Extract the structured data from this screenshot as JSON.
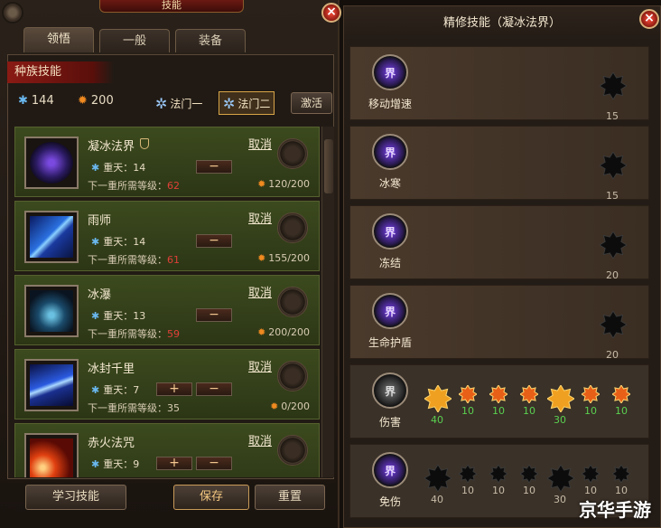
{
  "window": {
    "title": "技能"
  },
  "tabs": [
    {
      "label": "领悟"
    },
    {
      "label": "一般"
    },
    {
      "label": "装备"
    }
  ],
  "race_banner": "种族技能",
  "currency": {
    "blue": "144",
    "orange": "200"
  },
  "schools": [
    {
      "label": "法门一"
    },
    {
      "label": "法门二"
    }
  ],
  "activate_label": "激活",
  "skills": [
    {
      "name": "凝冰法界",
      "cancel": "取消",
      "level_label": "重天：14",
      "next_label": "下一重所需等级：",
      "next_level": "62",
      "points": "120/200"
    },
    {
      "name": "雨师",
      "cancel": "取消",
      "level_label": "重天：14",
      "next_label": "下一重所需等级：",
      "next_level": "61",
      "points": "155/200"
    },
    {
      "name": "冰瀑",
      "cancel": "取消",
      "level_label": "重天：13",
      "next_label": "下一重所需等级：",
      "next_level": "59",
      "points": "200/200"
    },
    {
      "name": "冰封千里",
      "cancel": "取消",
      "level_label": "重天：7",
      "next_label": "下一重所需等级：",
      "next_level": "35",
      "points": "0/200"
    },
    {
      "name": "赤火法咒",
      "cancel": "取消",
      "level_label": "重天：9",
      "next_label": "",
      "next_level": "",
      "points": ""
    }
  ],
  "bottom": {
    "learn": "学习技能",
    "save": "保存",
    "reset": "重置"
  },
  "right_panel": {
    "title": "精修技能（凝冰法界）",
    "icon_glyph": "界",
    "rows": [
      {
        "label": "移动增速",
        "nodes": [
          "15"
        ]
      },
      {
        "label": "冰寒",
        "nodes": [
          "15"
        ]
      },
      {
        "label": "冻结",
        "nodes": [
          "20"
        ]
      },
      {
        "label": "生命护盾",
        "nodes": [
          "20"
        ]
      },
      {
        "label": "伤害",
        "nodes": [
          "40",
          "10",
          "10",
          "10",
          "30",
          "10",
          "10"
        ]
      },
      {
        "label": "免伤",
        "nodes": [
          "40",
          "10",
          "10",
          "10",
          "30",
          "10",
          "10"
        ]
      }
    ]
  },
  "watermark": "京华手游",
  "colors": {
    "accent_red": "#8a1a14",
    "skill_row_green": "#3c4a1e",
    "level_red": "#e04038",
    "value_green": "#5ad050"
  }
}
